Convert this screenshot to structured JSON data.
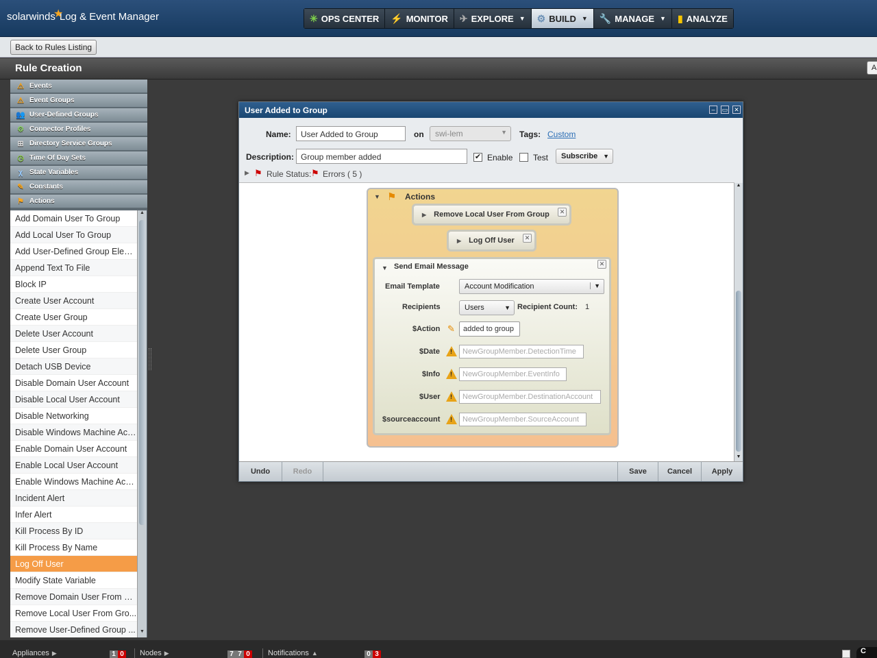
{
  "app": {
    "brand": "solarwinds",
    "product": "Log & Event Manager"
  },
  "nav": [
    {
      "label": "OPS CENTER",
      "icon": "ops-center-icon",
      "dropdown": false,
      "active": false
    },
    {
      "label": "MONITOR",
      "icon": "lightning-icon",
      "dropdown": false,
      "active": false
    },
    {
      "label": "EXPLORE",
      "icon": "explore-icon",
      "dropdown": true,
      "active": false
    },
    {
      "label": "BUILD",
      "icon": "gear-icon",
      "dropdown": true,
      "active": true
    },
    {
      "label": "MANAGE",
      "icon": "wrench-icon",
      "dropdown": true,
      "active": false
    },
    {
      "label": "ANALYZE",
      "icon": "bar-chart-icon",
      "dropdown": false,
      "active": false
    }
  ],
  "back_button": "Back to Rules Listing",
  "page_title": "Rule Creation",
  "right_stub": "A",
  "categories": [
    {
      "label": "Events",
      "icon": "warning-icon"
    },
    {
      "label": "Event Groups",
      "icon": "warning-group-icon"
    },
    {
      "label": "User-Defined Groups",
      "icon": "users-icon"
    },
    {
      "label": "Connector Profiles",
      "icon": "connector-icon"
    },
    {
      "label": "Directory Service Groups",
      "icon": "directory-icon"
    },
    {
      "label": "Time Of Day Sets",
      "icon": "clock-icon"
    },
    {
      "label": "State Variables",
      "icon": "variable-icon"
    },
    {
      "label": "Constants",
      "icon": "pencil-icon"
    },
    {
      "label": "Actions",
      "icon": "actions-icon"
    }
  ],
  "actions_list": [
    "Add Domain User To Group",
    "Add Local User To Group",
    "Add User-Defined Group Elem...",
    "Append Text To File",
    "Block IP",
    "Create User Account",
    "Create User Group",
    "Delete User Account",
    "Delete User Group",
    "Detach USB Device",
    "Disable Domain User Account",
    "Disable Local User Account",
    "Disable Networking",
    "Disable Windows Machine Acc...",
    "Enable Domain User Account",
    "Enable Local User Account",
    "Enable Windows Machine Acco...",
    "Incident Alert",
    "Infer Alert",
    "Kill Process By ID",
    "Kill Process By Name",
    "Log Off User",
    "Modify State Variable",
    "Remove Domain User From G...",
    "Remove Local User From Gro...",
    "Remove User-Defined Group ..."
  ],
  "selected_action": "Log Off User",
  "dialog": {
    "title": "User Added to Group",
    "name_label": "Name:",
    "name_value": "User Added to Group",
    "on_label": "on",
    "on_value": "swi-lem",
    "tags_label": "Tags:",
    "tags_link": "Custom",
    "description_label": "Description:",
    "description_value": "Group member added",
    "enable_label": "Enable",
    "enable_checked": true,
    "test_label": "Test",
    "test_checked": false,
    "subscribe_label": "Subscribe",
    "rule_status_label": "Rule Status:",
    "errors_label": "Errors ( 5 )",
    "actions_header": "Actions",
    "action_items": [
      "Remove Local User From Group",
      "Log Off User"
    ],
    "email": {
      "title": "Send Email Message",
      "template_label": "Email Template",
      "template_value": "Account Modification",
      "recipients_label": "Recipients",
      "recipients_value": "Users",
      "recipient_count_label": "Recipient Count:",
      "recipient_count_value": "1",
      "params": [
        {
          "label": "$Action",
          "value": "added to group",
          "state": "ok"
        },
        {
          "label": "$Date",
          "value": "NewGroupMember.DetectionTime",
          "state": "warning"
        },
        {
          "label": "$Info",
          "value": "NewGroupMember.EventInfo",
          "state": "warning"
        },
        {
          "label": "$User",
          "value": "NewGroupMember.DestinationAccount",
          "state": "warning"
        },
        {
          "label": "$sourceaccount",
          "value": "NewGroupMember.SourceAccount",
          "state": "warning"
        }
      ]
    },
    "footer": {
      "undo": "Undo",
      "redo": "Redo",
      "save": "Save",
      "cancel": "Cancel",
      "apply": "Apply"
    }
  },
  "bottom": {
    "appliances_label": "Appliances",
    "appliances_counts": [
      "1",
      "0"
    ],
    "nodes_label": "Nodes",
    "nodes_counts": [
      "7",
      "7",
      "0"
    ],
    "notifications_label": "Notifications",
    "notifications_counts": [
      "0",
      "3"
    ],
    "right_stub": "C"
  },
  "colors": {
    "accent": "#f59c47",
    "header": "#1a4671",
    "warning": "#e8a317",
    "error": "#cc0000"
  }
}
